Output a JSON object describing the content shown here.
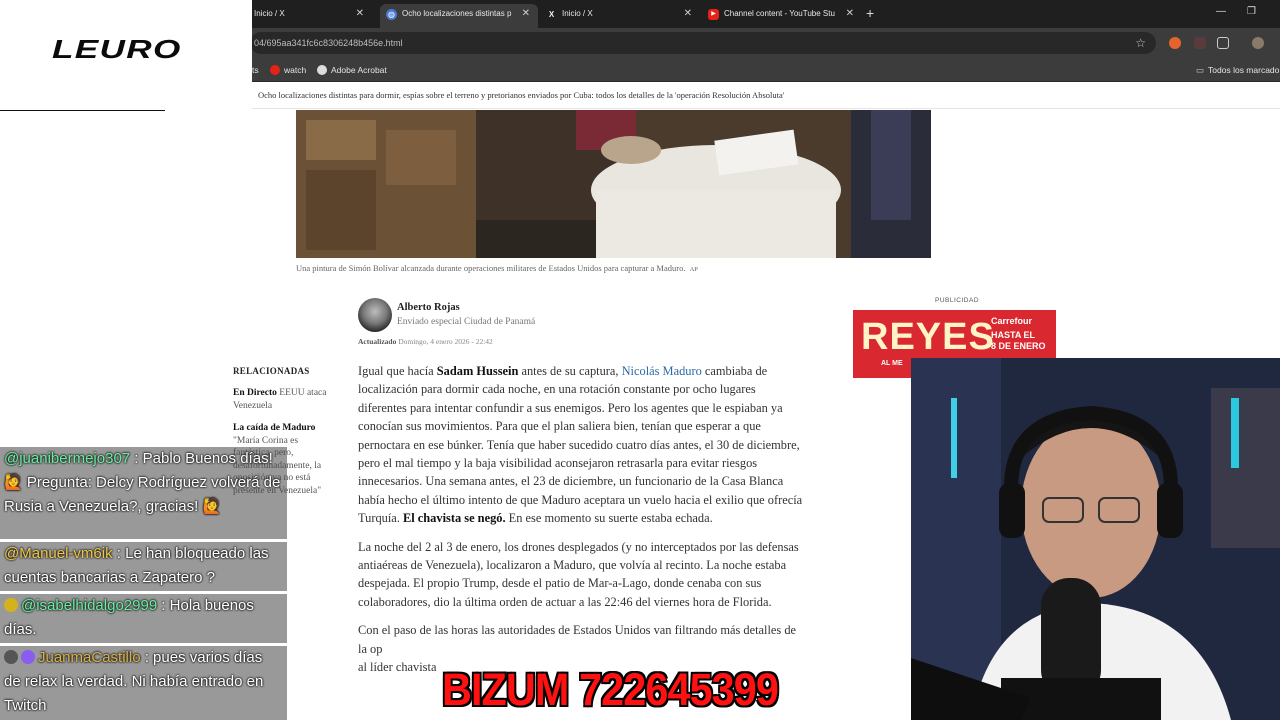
{
  "browser": {
    "tabs": [
      {
        "label": "Inicio / X",
        "favicon": "x-icon"
      },
      {
        "label": "Ocho localizaciones distintas p",
        "favicon": "globe-icon",
        "active": true
      },
      {
        "label": "Inicio / X",
        "favicon": "x-icon"
      },
      {
        "label": "Channel content - YouTube Stu",
        "favicon": "youtube-icon"
      }
    ],
    "url": "04/695aa341fc6c8306248b456e.html",
    "bookmarks": [
      {
        "label": "ts"
      },
      {
        "label": "watch",
        "icon": "youtube-icon"
      },
      {
        "label": "Adobe Acrobat",
        "icon": "acrobat-icon"
      }
    ],
    "all_bookmarks": "Todos los marcado"
  },
  "site": {
    "logo": "LEURO",
    "sticky_title": "Ocho localizaciones distintas para dormir, espías sobre el terreno y pretorianos enviados por Cuba: todos los detalles de la 'operación Resolución Absoluta'",
    "caption": "Una pintura de Simón Bolívar alcanzada durante operaciones militares de Estados Unidos para capturar a Maduro.",
    "caption_credit": "AP",
    "author": {
      "name": "Alberto Rojas",
      "role": "Enviado especial Ciudad de Panamá"
    },
    "updated_label": "Actualizado",
    "updated_date": "Domingo, 4 enero 2026 - 22:42",
    "related": {
      "heading": "RELACIONADAS",
      "items": [
        {
          "bold": "En Directo",
          "text": "EEUU ataca Venezuela"
        },
        {
          "bold": "La caída de Maduro",
          "text": "\"María Corina es fantástica, pero, desafortunadamente, la oposición ya no está presente en Venezuela\""
        }
      ]
    },
    "paragraphs": {
      "p1_a": "Igual que hacía ",
      "p1_b": "Sadam Hussein",
      "p1_c": " antes de su captura, ",
      "p1_d": "Nicolás Maduro",
      "p1_e": " cambiaba de localización para dormir cada noche, en una rotación constante por ocho lugares diferentes para intentar confundir a sus enemigos. Pero los agentes que le espiaban ya conocían sus movimientos. Para que el plan saliera bien, tenían que esperar a que pernoctara en ese búnker. Tenía que haber sucedido cuatro días antes, el 30 de diciembre, pero el mal tiempo y la baja visibilidad aconsejaron retrasarla para evitar riesgos innecesarios. Una semana antes, el 23 de diciembre, un funcionario de la Casa Blanca había hecho el último intento de que Maduro aceptara un vuelo hacia el exilio que ofrecía Turquía. ",
      "p1_f": "El chavista se negó.",
      "p1_g": " En ese momento su suerte estaba echada.",
      "p2": "La noche del 2 al 3 de enero, los drones desplegados (y no interceptados por las defensas antiaéreas de Venezuela), localizaron a Maduro, que volvía al recinto. La noche estaba despejada. El propio Trump, desde el patio de Mar-a-Lago, donde cenaba con sus colaboradores, dio la última orden de actuar a las 22:46 del viernes hora de Florida.",
      "p3": "Con el paso de las horas las autoridades de Estados Unidos van filtrando más detalles de la op",
      "p3_tail": "al líder chavista"
    },
    "ad": {
      "label": "PUBLICIDAD",
      "headline": "REYES",
      "brand": "Carrefour",
      "promo_line1": "HASTA EL",
      "promo_line2": "8 DE ENERO",
      "strip": "AL ME"
    }
  },
  "chat": [
    {
      "user": "@juanibermejo307",
      "text": " : Pablo Buenos días! 🙋 Pregunta: Delcy Rodríguez volverá de Rusia a Venezuela?, gracias! 🙋"
    },
    {
      "user": "@Manuel-vm6ik",
      "text": " : Le han bloqueado las cuentas bancarias a Zapatero ?"
    },
    {
      "user": "@isabelhidalgo2999",
      "text": " : Hola buenos días."
    },
    {
      "user": "JuanmaCastillo",
      "text": " : pues varios días de relax la verdad. Ni había entrado en Twitch"
    }
  ],
  "overlay": {
    "bizum": "BIZUM 722645399"
  },
  "colors": {
    "accent_link": "#2d6aa3",
    "bizum_red": "#ff1111",
    "ad_red": "#d9282f"
  }
}
